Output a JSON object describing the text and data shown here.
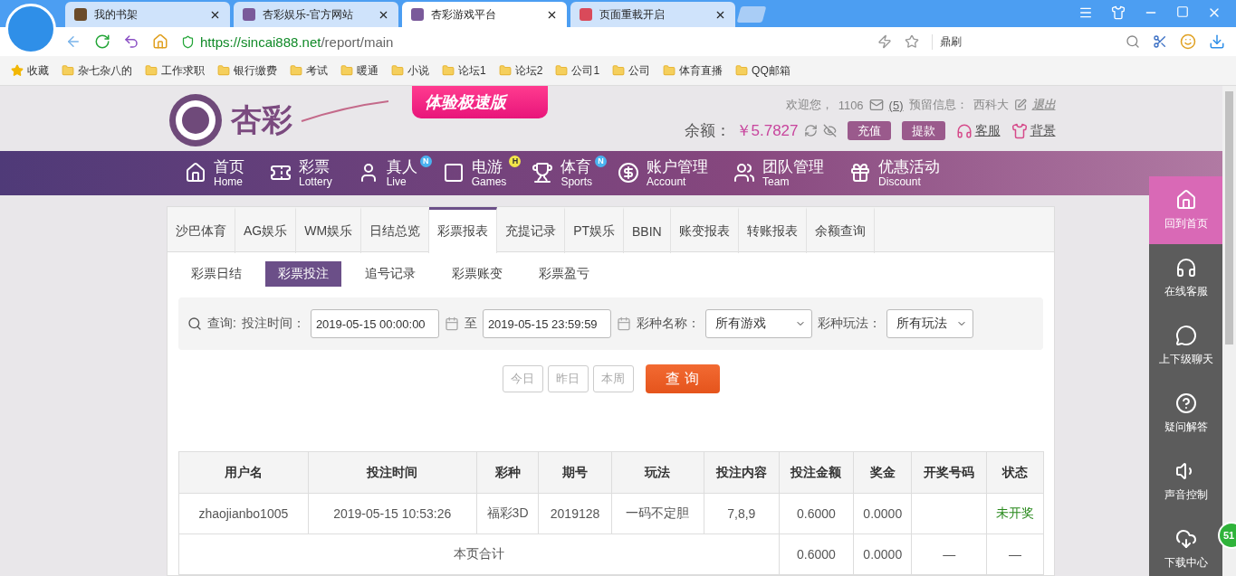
{
  "browser": {
    "tabs": [
      {
        "title": "我的书架",
        "selected": false
      },
      {
        "title": "杏彩娱乐-官方网站",
        "selected": false
      },
      {
        "title": "杏彩游戏平台",
        "selected": true
      },
      {
        "title": "页面重載开启",
        "selected": false
      }
    ],
    "url": {
      "host": "https://sincai888.net",
      "path": "/report/main"
    },
    "search": "鼎刷",
    "bookmarks": [
      "收藏",
      "杂七杂八的",
      "工作求职",
      "银行缴费",
      "考试",
      "暖通",
      "小说",
      "论坛1",
      "论坛2",
      "公司1",
      "公司",
      "体育直播",
      "QQ邮箱"
    ]
  },
  "header": {
    "logo": "杏彩",
    "promo": "体验极速版",
    "welcome": "欢迎您，",
    "user": "1106",
    "messages": "(5)",
    "reserved_label": "预留信息：",
    "reserved": "西科大",
    "logout": "退出",
    "balance_label": "余额：",
    "balance": "￥5.7827",
    "buttons": [
      "充值",
      "提款"
    ],
    "links": [
      "客服",
      "背景"
    ]
  },
  "nav": [
    {
      "title": "首页",
      "subtitle": "Home"
    },
    {
      "title": "彩票",
      "subtitle": "Lottery"
    },
    {
      "title": "真人",
      "subtitle": "Live",
      "badge": "N"
    },
    {
      "title": "电游",
      "subtitle": "Games",
      "badge": "H"
    },
    {
      "title": "体育",
      "subtitle": "Sports",
      "badge": "N"
    },
    {
      "title": "账户管理",
      "subtitle": "Account"
    },
    {
      "title": "团队管理",
      "subtitle": "Team"
    },
    {
      "title": "优惠活动",
      "subtitle": "Discount"
    }
  ],
  "report_tabs": [
    {
      "label": "沙巴体育",
      "selected": false
    },
    {
      "label": "AG娱乐",
      "selected": false
    },
    {
      "label": "WM娱乐",
      "selected": false
    },
    {
      "label": "日结总览",
      "selected": false
    },
    {
      "label": "彩票报表",
      "selected": true
    },
    {
      "label": "充提记录",
      "selected": false
    },
    {
      "label": "PT娱乐",
      "selected": false
    },
    {
      "label": "BBIN",
      "selected": false
    },
    {
      "label": "账变报表",
      "selected": false
    },
    {
      "label": "转账报表",
      "selected": false
    },
    {
      "label": "余额查询",
      "selected": false
    }
  ],
  "sub_tabs": [
    {
      "label": "彩票日结",
      "selected": false
    },
    {
      "label": "彩票投注",
      "selected": true
    },
    {
      "label": "追号记录",
      "selected": false
    },
    {
      "label": "彩票账变",
      "selected": false
    },
    {
      "label": "彩票盈亏",
      "selected": false
    }
  ],
  "filter": {
    "query_label": "查询:",
    "time_label": "投注时间：",
    "start": "2019-05-15 00:00:00",
    "to": "至",
    "end": "2019-05-15 23:59:59",
    "lottery_label": "彩种名称：",
    "lottery": "所有游戏",
    "play_label": "彩种玩法：",
    "play": "所有玩法",
    "quick": [
      "今日",
      "昨日",
      "本周"
    ],
    "search_button": "查 询"
  },
  "table": {
    "columns": [
      "用户名",
      "投注时间",
      "彩种",
      "期号",
      "玩法",
      "投注内容",
      "投注金额",
      "奖金",
      "开奖号码",
      "状态"
    ],
    "rows": [
      [
        "zhaojianbo1005",
        "2019-05-15 10:53:26",
        "福彩3D",
        "2019128",
        "一码不定胆",
        "7,8,9",
        "0.6000",
        "0.0000",
        "",
        "未开奖"
      ]
    ],
    "total": {
      "label": "本页合计",
      "amount": "0.6000",
      "prize": "0.0000",
      "draw": "—",
      "status": "—"
    }
  },
  "side_panel": [
    {
      "label": "回到首页",
      "selected": true
    },
    {
      "label": "在线客服",
      "selected": false
    },
    {
      "label": "上下级聊天",
      "selected": false
    },
    {
      "label": "疑问解答",
      "selected": false
    },
    {
      "label": "声音控制",
      "selected": false
    },
    {
      "label": "下载中心",
      "selected": false
    }
  ],
  "badge": "51"
}
